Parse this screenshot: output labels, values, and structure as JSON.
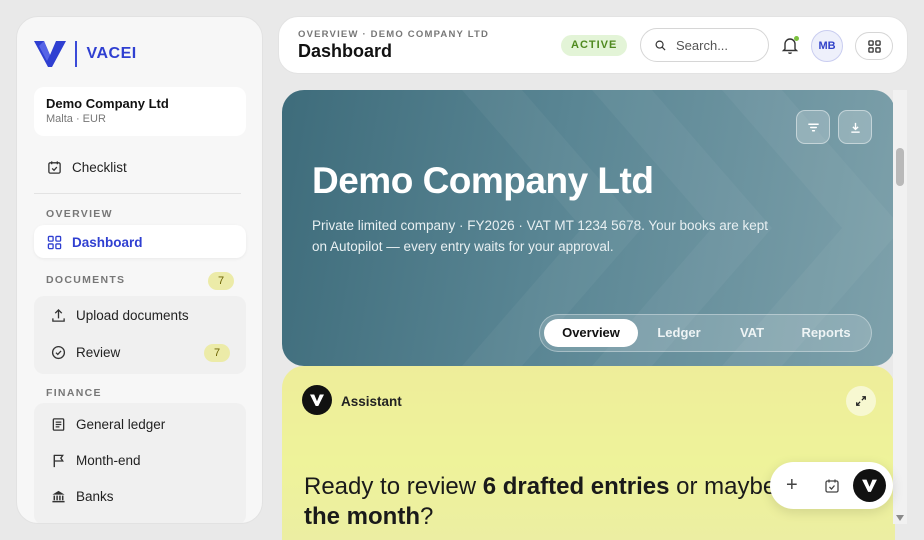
{
  "brand": {
    "name": "VACEI",
    "color": "#2f3fd1"
  },
  "company": {
    "name": "Demo Company Ltd",
    "meta": "Malta · EUR"
  },
  "sidebar": {
    "checklist": {
      "label": "Checklist",
      "icon": "checklist-icon"
    },
    "sections": {
      "overview": "OVERVIEW",
      "documents": "DOCUMENTS",
      "finance": "FINANCE"
    },
    "documents_count": "7",
    "items": {
      "dashboard": {
        "label": "Dashboard",
        "icon": "grid-icon",
        "active": true
      },
      "upload": {
        "label": "Upload documents",
        "icon": "upload-icon"
      },
      "review": {
        "label": "Review",
        "icon": "check-circle-icon",
        "count": "7"
      },
      "ledger": {
        "label": "General ledger",
        "icon": "ledger-icon"
      },
      "month_end": {
        "label": "Month-end",
        "icon": "flag-icon"
      },
      "banks": {
        "label": "Banks",
        "icon": "bank-icon"
      }
    }
  },
  "header": {
    "breadcrumb": "OVERVIEW · DEMO COMPANY LTD",
    "title": "Dashboard",
    "status": "ACTIVE",
    "status_color": "#4f8a1f",
    "search_placeholder": "Search...",
    "avatar_initials": "MB"
  },
  "hero": {
    "title": "Demo Company Ltd",
    "description": "Private limited company · FY2026 · VAT MT 1234 5678. Your books are kept on Autopilot — every entry waits for your approval.",
    "tabs": [
      "Overview",
      "Ledger",
      "VAT",
      "Reports"
    ],
    "active_tab": "Overview"
  },
  "assistant": {
    "label": "Assistant",
    "message_prefix": "Ready to review ",
    "message_bold1": "6 drafted entries",
    "message_mid": " or maybe ",
    "message_bold2": "the month",
    "message_suffix": "?"
  }
}
